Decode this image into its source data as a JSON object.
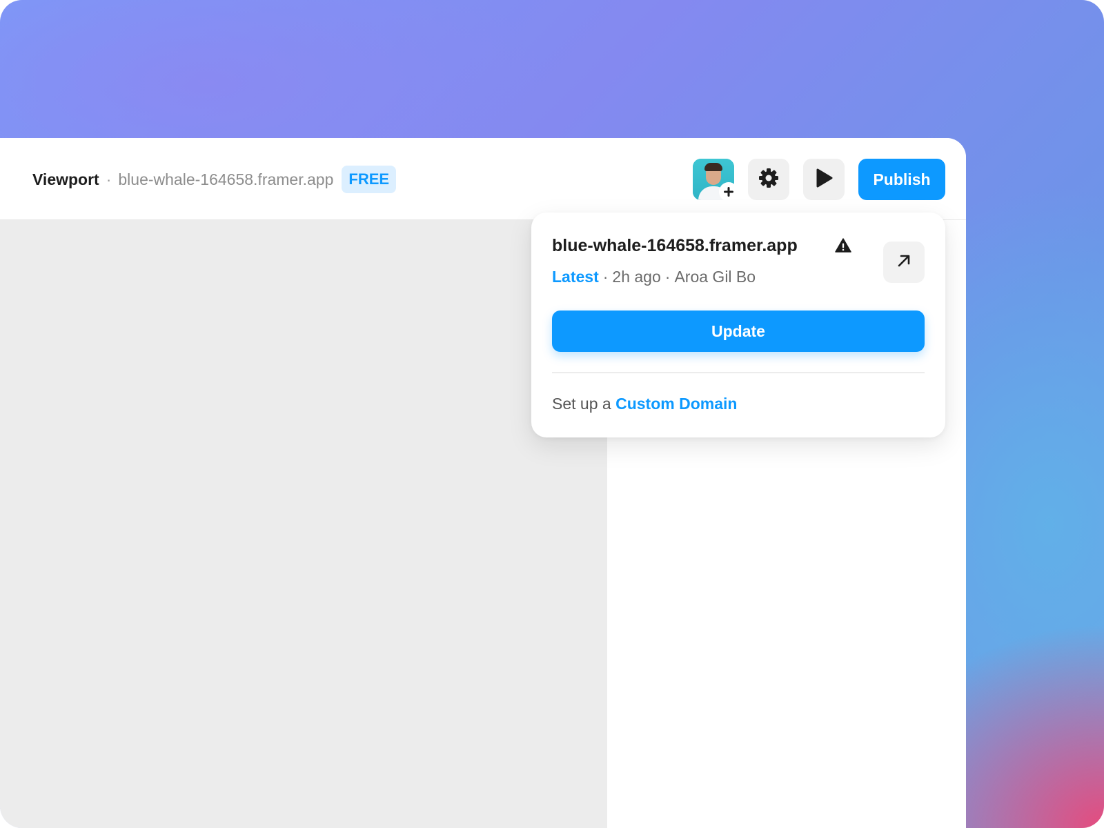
{
  "toolbar": {
    "app_name": "Viewport",
    "separator": "·",
    "site_url": "blue-whale-164658.framer.app",
    "plan_badge": "FREE",
    "publish_label": "Publish"
  },
  "icons": {
    "avatar": "user-avatar-with-add",
    "settings": "gear-icon",
    "preview": "play-icon",
    "open": "arrow-up-right-icon",
    "warning": "warning-triangle-icon"
  },
  "popover": {
    "url": "blue-whale-164658.framer.app",
    "status": "Latest",
    "dot1": "·",
    "time": "2h ago",
    "dot2": "·",
    "author": "Aroa Gil Bo",
    "update_label": "Update",
    "domain_prefix": "Set up a",
    "domain_link": "Custom Domain"
  },
  "colors": {
    "accent": "#0d99ff",
    "badge_bg": "#dcefff",
    "canvas": "#ececec"
  }
}
